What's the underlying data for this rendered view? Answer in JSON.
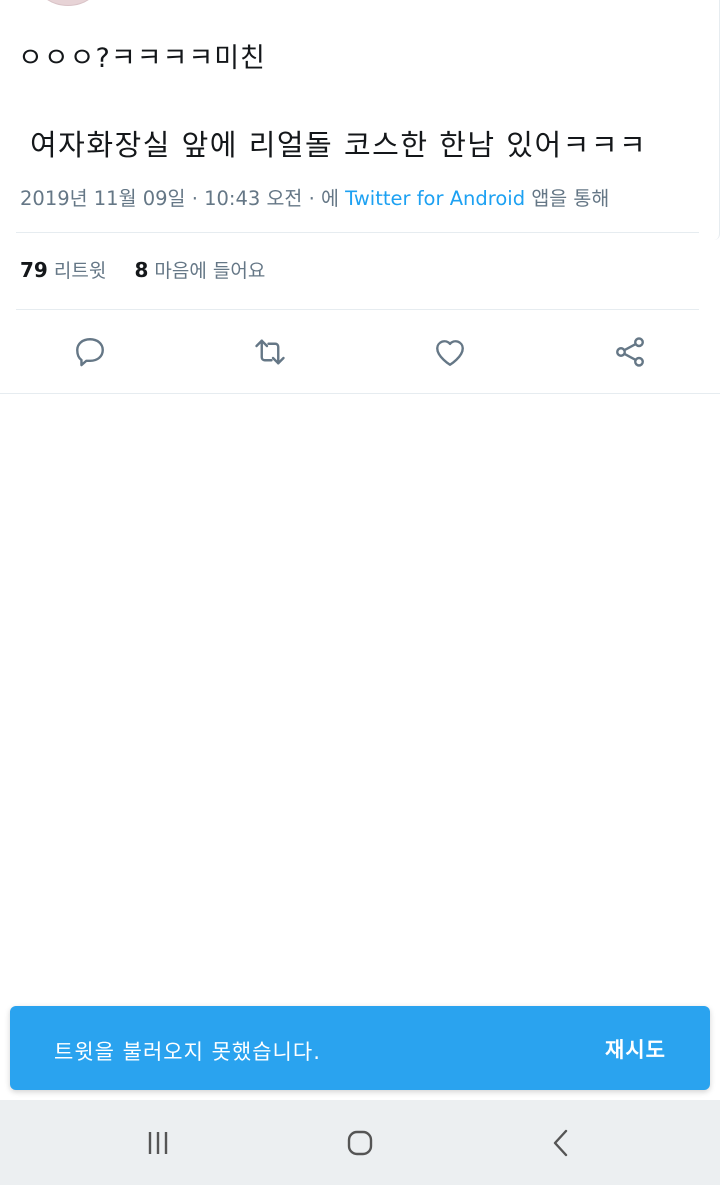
{
  "tweet": {
    "reply_line": "ㅇㅇㅇ?ㅋㅋㅋㅋ미친",
    "text": "여자화장실 앞에 리얼돌 코스한 한남 있어ㅋㅋㅋ",
    "date": "2019년 11월 09일",
    "time": "10:43 오전",
    "via_prefix": "에",
    "client": "Twitter for Android",
    "via_suffix": "앱을 통해"
  },
  "stats": {
    "retweets_count": "79",
    "retweets_label": "리트윗",
    "likes_count": "8",
    "likes_label": "마음에 들어요"
  },
  "actions": {
    "icons": [
      "reply-icon",
      "retweet-icon",
      "like-icon",
      "share-icon"
    ]
  },
  "snackbar": {
    "message": "트윗을 불러오지 못했습니다.",
    "action_label": "재시도"
  },
  "navbar": {
    "icons": [
      "recent-apps-icon",
      "home-icon",
      "back-icon"
    ]
  },
  "colors": {
    "accent": "#1da1f2",
    "snackbar_bg": "#2aa3ef",
    "muted_text": "#657786",
    "divider": "#e6ecf0",
    "navbar_bg": "#eceff1"
  }
}
